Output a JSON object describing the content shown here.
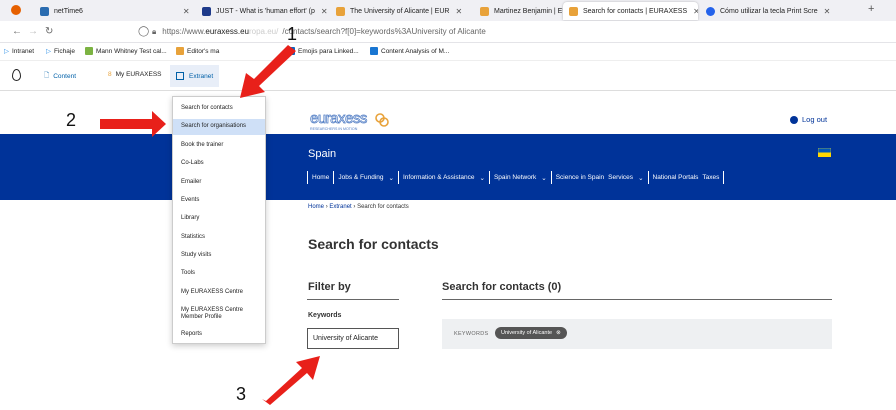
{
  "browser": {
    "tabs": [
      {
        "label": "netTime6",
        "color": "#2b6cb0"
      },
      {
        "label": "JUST - What is 'human effort' (p",
        "color": "#1e3a8a"
      },
      {
        "label": "The University of Alicante | EUR",
        "color": "#e8a23a"
      },
      {
        "label": "Martinez Benjamin | EURAXESS",
        "color": "#e8a23a"
      },
      {
        "label": "Search for contacts | EURAXESS",
        "color": "#e8a23a"
      },
      {
        "label": "Cómo utilizar la tecla Print Scre",
        "color": "#2563eb"
      }
    ],
    "url_prefix": "https://www.",
    "url_domain": "euraxess.eu",
    "url_fragment_a": "ropa.eu/",
    "url_fragment_b": "/contacts/search?f[0]=keywords%3AUniversity of Alicante",
    "bookmarks": [
      {
        "label": "Intranet",
        "color": "#1e88e5"
      },
      {
        "label": "Fichaje",
        "color": "#1e88e5"
      },
      {
        "label": "Mann Whitney Test cal...",
        "color": "#7cb342"
      },
      {
        "label": "Editor's ma",
        "color": "#e8a23a"
      },
      {
        "label": "Emojis para Linked...",
        "color": "#0a66c2"
      },
      {
        "label": "Content Analysis of M...",
        "color": "#1976d2"
      }
    ]
  },
  "toolbar": {
    "content": "Content",
    "my_euraxess": "My EURAXESS",
    "extranet": "Extranet"
  },
  "menu": {
    "items": [
      "Search for contacts",
      "Search for organisations",
      "Book the trainer",
      "Co-Labs",
      "Emailer",
      "Events",
      "Library",
      "Statistics",
      "Study visits",
      "Tools",
      "My EURAXESS Centre",
      "My EURAXESS Centre",
      "Member Profile",
      "Reports"
    ]
  },
  "site": {
    "logo_text": "EURAXESS",
    "logo_tagline": "RESEARCHERS IN MOTION",
    "logout": "Log out",
    "country": "Spain",
    "nav": [
      "Home",
      "Jobs & Funding",
      "Information & Assistance",
      "Spain Network",
      "Science in Spain",
      "Services",
      "National Portals",
      "Taxes"
    ],
    "breadcrumb": {
      "home": "Home",
      "extranet": "Extranet",
      "current": "Search for contacts"
    },
    "page_title": "Search for contacts",
    "filter_heading": "Filter by",
    "keywords_label": "Keywords",
    "keywords_value": "University of Alicante",
    "results_heading": "Search for contacts (0)",
    "results_kw_label": "KEYWORDS",
    "chip_text": "University of Alicante"
  },
  "annotations": {
    "n1": "1",
    "n2": "2",
    "n3": "3",
    "arrow_color": "#e8201a"
  },
  "colors": {
    "brand": "#003399",
    "highlight": "#cfe0f7"
  }
}
